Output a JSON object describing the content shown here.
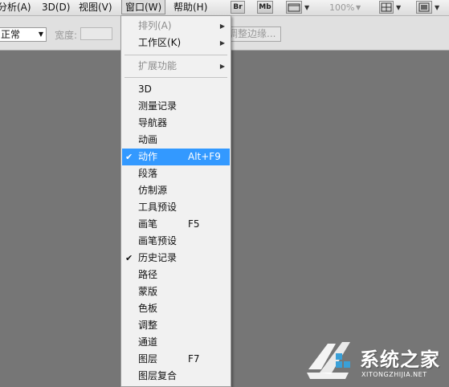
{
  "menubar": {
    "items": [
      {
        "label": "分析(A)"
      },
      {
        "label": "3D(D)"
      },
      {
        "label": "视图(V)"
      },
      {
        "label": "窗口(W)"
      },
      {
        "label": "帮助(H)"
      }
    ],
    "bridge_label": "Br",
    "minibridge_label": "Mb",
    "zoom_value": "100%"
  },
  "options_bar": {
    "mode_value": "正常",
    "width_label": "宽度:",
    "width_value": "",
    "refine_edge_label": "调整边缘..."
  },
  "window_menu": {
    "items": [
      {
        "label": "排列(A)",
        "disabled": true,
        "submenu": true
      },
      {
        "label": "工作区(K)",
        "submenu": true
      },
      {
        "label": "扩展功能",
        "disabled": true,
        "submenu": true
      },
      {
        "label": "3D"
      },
      {
        "label": "测量记录"
      },
      {
        "label": "导航器"
      },
      {
        "label": "动画"
      },
      {
        "label": "动作",
        "shortcut": "Alt+F9",
        "checked": true,
        "highlighted": true
      },
      {
        "label": "段落"
      },
      {
        "label": "仿制源"
      },
      {
        "label": "工具预设"
      },
      {
        "label": "画笔",
        "shortcut": "F5"
      },
      {
        "label": "画笔预设"
      },
      {
        "label": "历史记录",
        "checked": true
      },
      {
        "label": "路径"
      },
      {
        "label": "蒙版"
      },
      {
        "label": "色板"
      },
      {
        "label": "调整"
      },
      {
        "label": "通道"
      },
      {
        "label": "图层",
        "shortcut": "F7"
      },
      {
        "label": "图层复合"
      }
    ],
    "check_glyph": "✔",
    "submenu_glyph": "▶"
  },
  "watermark": {
    "title": "系统之家",
    "subtitle": "XITONGZHIJIA.NET"
  },
  "colors": {
    "highlight": "#3399ff",
    "canvas": "#767676"
  }
}
